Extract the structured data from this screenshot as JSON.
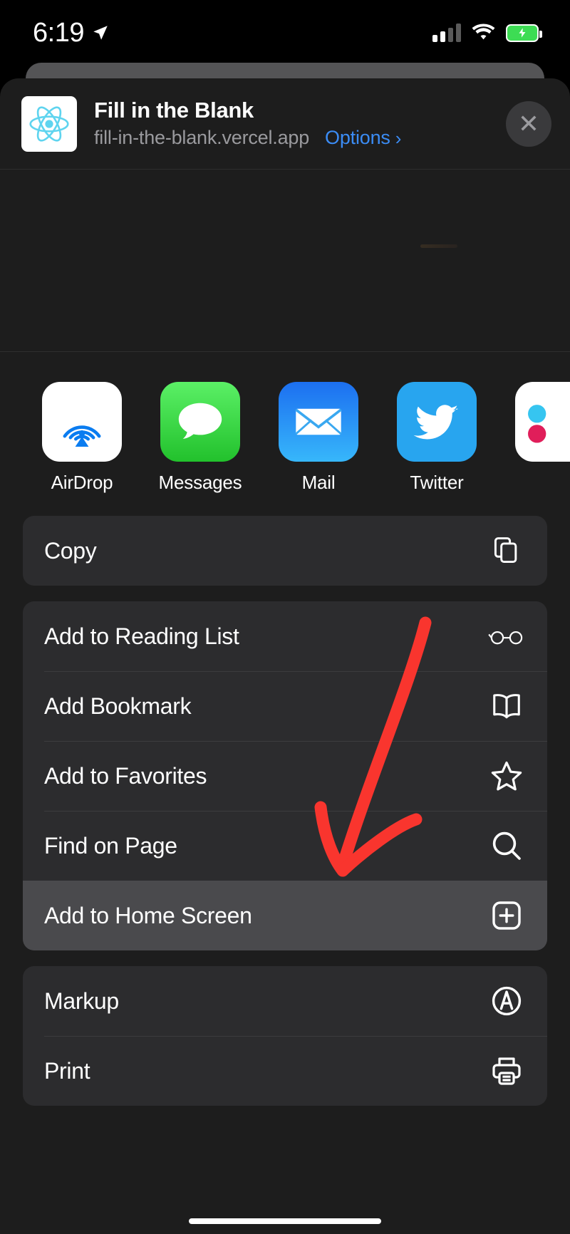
{
  "status_bar": {
    "time": "6:19",
    "location_icon": "location-arrow-icon",
    "cellular_icon": "cellular-bars-icon",
    "cellular_bars_filled": 2,
    "cellular_bars_total": 4,
    "wifi_icon": "wifi-icon",
    "battery_icon": "battery-charging-icon",
    "battery_color": "#3ddc54"
  },
  "share_sheet": {
    "app_icon": "react-logo-icon",
    "title": "Fill in the Blank",
    "subtitle": "fill-in-the-blank.vercel.app",
    "options_label": "Options",
    "options_chevron": "chevron-right-icon",
    "close_icon": "close-icon",
    "close_glyph": "✕"
  },
  "apps": [
    {
      "label": "AirDrop",
      "icon": "airdrop-icon",
      "bg": "#ffffff"
    },
    {
      "label": "Messages",
      "icon": "messages-icon",
      "bg": "#4cd454"
    },
    {
      "label": "Mail",
      "icon": "mail-icon",
      "bg": "#1f8cf5"
    },
    {
      "label": "Twitter",
      "icon": "twitter-icon",
      "bg": "#2aa3ef"
    },
    {
      "label": "",
      "icon": "partial-app-icon",
      "bg": "#ffffff"
    }
  ],
  "action_groups": [
    {
      "rows": [
        {
          "label": "Copy",
          "icon": "copy-icon",
          "active": false
        }
      ]
    },
    {
      "rows": [
        {
          "label": "Add to Reading List",
          "icon": "glasses-icon",
          "active": false
        },
        {
          "label": "Add Bookmark",
          "icon": "book-icon",
          "active": false
        },
        {
          "label": "Add to Favorites",
          "icon": "star-icon",
          "active": false
        },
        {
          "label": "Find on Page",
          "icon": "search-icon",
          "active": false
        },
        {
          "label": "Add to Home Screen",
          "icon": "plus-square-icon",
          "active": true
        }
      ]
    },
    {
      "rows": [
        {
          "label": "Markup",
          "icon": "markup-icon",
          "active": false
        },
        {
          "label": "Print",
          "icon": "print-icon",
          "active": false
        }
      ]
    }
  ],
  "annotation": {
    "type": "hand-drawn-arrow",
    "color": "#f9352e",
    "points_to": "Add to Home Screen"
  },
  "colors": {
    "sheet_bg": "#1d1d1d",
    "card_bg": "#2c2c2e",
    "row_active_bg": "#4a4a4d",
    "accent_blue": "#3b8cf5",
    "text_primary": "#ffffff",
    "text_secondary": "#9a9a9e"
  }
}
